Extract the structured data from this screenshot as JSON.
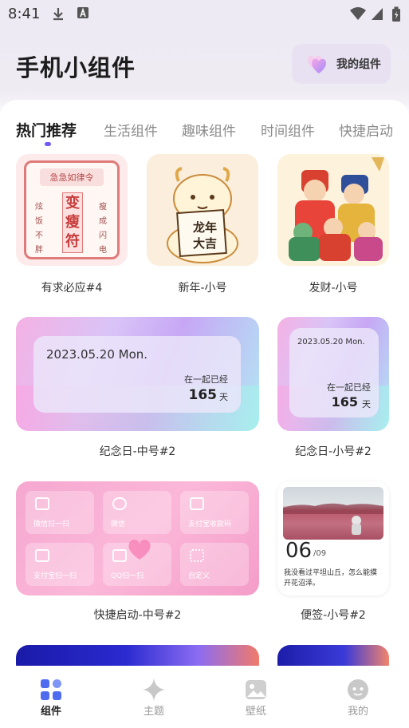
{
  "status": {
    "time": "8:41"
  },
  "header": {
    "title": "手机小组件",
    "my_widgets": "我的组件"
  },
  "tabs": [
    {
      "label": "热门推荐",
      "active": true
    },
    {
      "label": "生活组件"
    },
    {
      "label": "趣味组件"
    },
    {
      "label": "时间组件"
    },
    {
      "label": "快捷启动"
    }
  ],
  "widgets": {
    "w1": {
      "caption": "有求必应#4",
      "sign": "急急如律令",
      "big": [
        "变",
        "瘦",
        "符"
      ],
      "left": [
        "炫",
        "饭",
        "不",
        "胖"
      ],
      "right": [
        "瘦",
        "成",
        "闪",
        "电"
      ]
    },
    "w2": {
      "caption": "新年-小号",
      "lines": [
        "龙年",
        "大吉"
      ]
    },
    "w3": {
      "caption": "发财-小号"
    },
    "w4": {
      "caption": "纪念日-中号#2",
      "date": "2023.05.20 Mon.",
      "with": "在一起已经",
      "days": "165",
      "unit": "天"
    },
    "w5": {
      "caption": "纪念日-小号#2",
      "date": "2023.05.20 Mon.",
      "with": "在一起已经",
      "days": "165",
      "unit": "天"
    },
    "w6": {
      "caption": "快捷启动-中号#2",
      "tiles": [
        "微信扫一扫",
        "微信",
        "支付宝收款码",
        "支付宝扫一扫",
        "QQ扫一扫",
        "自定义"
      ]
    },
    "w7": {
      "caption": "便签-小号#2",
      "day": "06",
      "month": "/09",
      "text1": "我没看过平坦山丘，怎么能摸",
      "text2": "开花沼泽。"
    }
  },
  "nav": [
    {
      "label": "组件",
      "active": true,
      "icon": "grid-icon"
    },
    {
      "label": "主题",
      "icon": "sparkle-icon"
    },
    {
      "label": "壁纸",
      "icon": "image-icon"
    },
    {
      "label": "我的",
      "icon": "face-icon"
    }
  ],
  "colors": {
    "accent": "#6d5cf3",
    "nav_active": "#4f6cf0"
  }
}
